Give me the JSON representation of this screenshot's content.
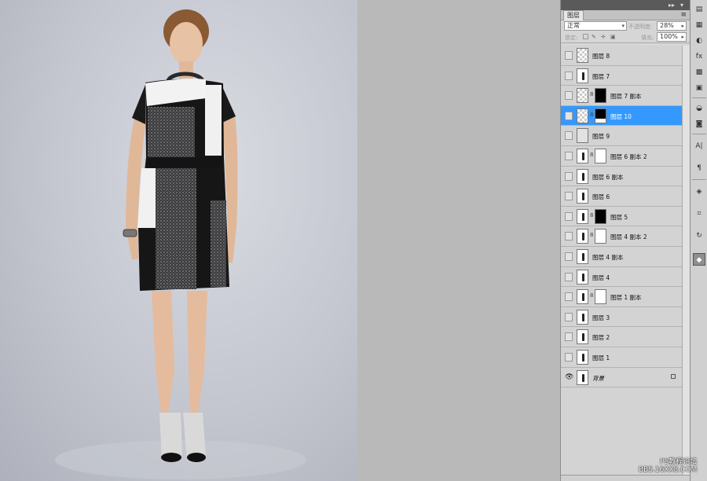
{
  "panel": {
    "tab_label": "图层",
    "blend_mode": "正常",
    "opacity_label": "不透明度:",
    "opacity_value": "28%",
    "lock_label": "锁定:",
    "fill_label": "填充:",
    "fill_value": "100%"
  },
  "layers": [
    {
      "name": "图层 8",
      "thumb": "checker",
      "mask": null,
      "selected": false,
      "visible": false
    },
    {
      "name": "图层 7",
      "thumb": "fig",
      "mask": null,
      "selected": false,
      "visible": false
    },
    {
      "name": "图层 7 副本",
      "thumb": "checker",
      "mask": "black",
      "selected": false,
      "visible": false
    },
    {
      "name": "图层 10",
      "thumb": "checker",
      "mask": "blackwhite",
      "selected": true,
      "visible": false
    },
    {
      "name": "图层 9",
      "thumb": "gray",
      "mask": null,
      "selected": false,
      "visible": false
    },
    {
      "name": "图层 6 副本 2",
      "thumb": "fig",
      "mask": "white",
      "selected": false,
      "visible": false
    },
    {
      "name": "图层 6 副本",
      "thumb": "fig",
      "mask": null,
      "selected": false,
      "visible": false
    },
    {
      "name": "图层 6",
      "thumb": "fig",
      "mask": null,
      "selected": false,
      "visible": false
    },
    {
      "name": "图层 5",
      "thumb": "fig",
      "mask": "black",
      "selected": false,
      "visible": false
    },
    {
      "name": "图层 4 副本 2",
      "thumb": "fig",
      "mask": "white",
      "selected": false,
      "visible": false
    },
    {
      "name": "图层 4 副本",
      "thumb": "fig",
      "mask": null,
      "selected": false,
      "visible": false
    },
    {
      "name": "图层 4",
      "thumb": "fig",
      "mask": null,
      "selected": false,
      "visible": false
    },
    {
      "name": "图层 1 副本",
      "thumb": "fig",
      "mask": "white",
      "selected": false,
      "visible": false
    },
    {
      "name": "图层 3",
      "thumb": "fig",
      "mask": null,
      "selected": false,
      "visible": false
    },
    {
      "name": "图层 2",
      "thumb": "fig",
      "mask": null,
      "selected": false,
      "visible": false
    },
    {
      "name": "图层 1",
      "thumb": "fig",
      "mask": null,
      "selected": false,
      "visible": false
    },
    {
      "name": "背景",
      "thumb": "fig",
      "mask": null,
      "selected": false,
      "visible": true,
      "locked": true
    }
  ],
  "watermark": {
    "line1": "PS教程论坛",
    "line2": "BBS.16XX8.COM"
  },
  "colors": {
    "selection": "#3399ff",
    "panel_bg": "#d6d6d6",
    "workspace": "#b9b9b9"
  }
}
